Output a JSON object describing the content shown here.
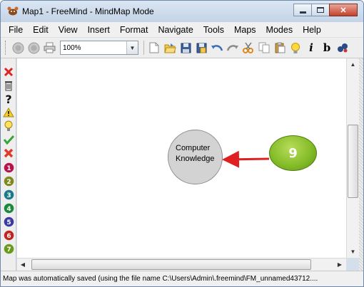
{
  "window": {
    "title": "Map1 - FreeMind - MindMap Mode"
  },
  "menu": [
    "File",
    "Edit",
    "View",
    "Insert",
    "Format",
    "Navigate",
    "Tools",
    "Maps",
    "Modes",
    "Help"
  ],
  "toolbar": {
    "zoom_value": "100%",
    "bold_label": "b",
    "italic_label": "i"
  },
  "left_icons": [
    "delete-icon",
    "trash-icon",
    "question-icon",
    "warning-icon",
    "idea-icon",
    "check-icon",
    "cross-icon",
    "priority-1-icon",
    "priority-2-icon",
    "priority-3-icon",
    "priority-4-icon",
    "priority-5-icon",
    "priority-6-icon",
    "priority-7-icon"
  ],
  "left_icon_numbers": [
    "1",
    "2",
    "3",
    "4",
    "5",
    "6",
    "7"
  ],
  "map": {
    "node_text": "Computer\nKnowledge",
    "badge_text": "9",
    "node_color": "#d3d3d3",
    "badge_color": "#86bd2a",
    "arrow_color": "#e02020"
  },
  "status": {
    "text": "Map was automatically saved (using the file name C:\\Users\\Admin\\.freemind\\FM_unnamed43712...."
  }
}
